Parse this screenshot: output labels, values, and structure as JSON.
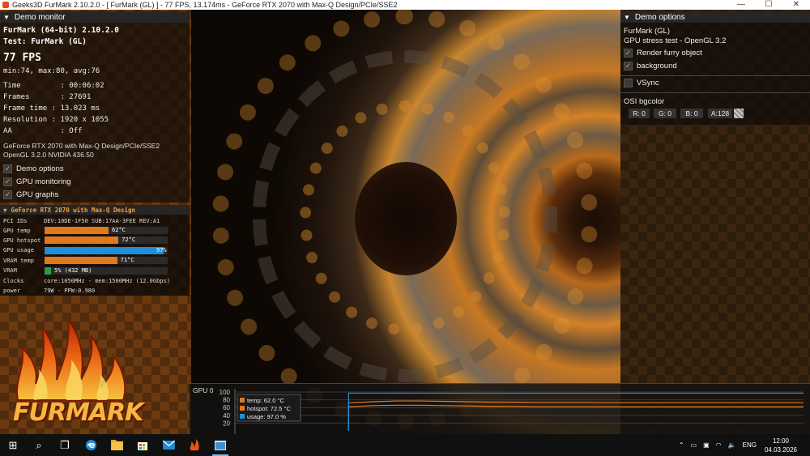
{
  "window": {
    "title": "Geeks3D FurMark 2.10.2.0 - [ FurMark (GL) ] - 77 FPS, 13.174ms - GeForce RTX 2070 with Max-Q Design/PCIe/SSE2",
    "minimize": "—",
    "maximize": "☐",
    "close": "✕"
  },
  "demo_monitor": {
    "header": "Demo monitor",
    "app_name": "FurMark (64-bit) 2.10.2.0",
    "test_name": "Test: FurMark (GL)",
    "fps": "77 FPS",
    "fps_stats": "min:74, max:80, avg:76",
    "time": "Time         : 00:06:02",
    "frames": "Frames       : 27691",
    "frame_time": "Frame time : 13.023 ms",
    "resolution": "Resolution : 1920 x 1055",
    "aa": "AA           : Off",
    "renderer": "GeForce RTX 2070 with Max-Q Design/PCIe/SSE2",
    "gl_version": "OpenGL 3.2.0 NVIDIA 436.50",
    "options": [
      {
        "label": "Demo options",
        "checked": true
      },
      {
        "label": "GPU monitoring",
        "checked": true
      },
      {
        "label": "GPU graphs",
        "checked": true
      }
    ]
  },
  "gpu": {
    "header": "GeForce RTX 2070 with Max-Q Design",
    "pci_label": "PCI IDs",
    "pci_value": "DEV:10DE-1F50 SUB:17AA-3FEE REV:A1",
    "rows": [
      {
        "label": "GPU temp",
        "value": "62°C",
        "fraction": 0.52,
        "color": "#e07820"
      },
      {
        "label": "GPU hotspot",
        "value": "72°C",
        "fraction": 0.6,
        "color": "#e07820"
      },
      {
        "label": "GPU usage",
        "value": "97%",
        "fraction": 0.97,
        "color": "#1e8fd8"
      },
      {
        "label": "VRAM temp",
        "value": "71°C",
        "fraction": 0.59,
        "color": "#e07820"
      },
      {
        "label": "VRAM",
        "value": "5% (432 MB)",
        "fraction": 0.05,
        "color": "#2a9d4a"
      }
    ],
    "clocks_label": "Clocks",
    "clocks_value": "core:1050MHz - mem:1500MHz (12.0Gbps)",
    "power_label": "power",
    "power_value": "79W - PPW:0.980"
  },
  "logo": {
    "text": "FURMARK"
  },
  "demo_options": {
    "header": "Demo options",
    "scene": "FurMark (GL)",
    "subtitle": "GPU stress test - OpenGL 3.2",
    "render_furry": {
      "label": "Render furry object",
      "checked": true
    },
    "background": {
      "label": "background",
      "checked": true
    },
    "vsync": {
      "label": "VSync",
      "checked": false
    },
    "bgcolor_label": "OSI bgcolor",
    "r": "R: 0",
    "g": "G: 0",
    "b": "B: 0",
    "a": "A:128"
  },
  "graph": {
    "title": "GPU 0",
    "y_ticks": [
      "100",
      "80",
      "60",
      "40",
      "20"
    ],
    "legend": [
      {
        "label": "temp: 62.0 °C",
        "color": "#e07820"
      },
      {
        "label": "hotspot: 72.5 °C",
        "color": "#e07820"
      },
      {
        "label": "usage: 97.0 %",
        "color": "#1e8fd8"
      }
    ]
  },
  "chart_data": {
    "type": "line",
    "title": "GPU 0",
    "ylim": [
      0,
      100
    ],
    "series": [
      {
        "name": "temp: 62.0 °C",
        "color": "#e07820",
        "start": 0.2,
        "values": [
          62,
          65,
          66,
          66,
          65,
          64,
          63,
          63,
          62,
          62,
          62,
          62,
          62,
          62,
          62,
          62,
          62,
          62,
          62,
          62
        ]
      },
      {
        "name": "hotspot: 72.5 °C",
        "color": "#e07820",
        "start": 0.2,
        "values": [
          72,
          75,
          77,
          77,
          76,
          75,
          74,
          74,
          73,
          73,
          73,
          72.5,
          72.5,
          72.5,
          72.5,
          72.5,
          72.5,
          72.5,
          72.5,
          72.5
        ]
      },
      {
        "name": "usage: 97.0 %",
        "color": "#1e8fd8",
        "start": 0.2,
        "values": [
          97,
          97,
          97,
          97,
          97,
          97,
          97,
          97,
          97,
          97,
          97,
          97,
          97,
          97,
          97,
          97,
          97,
          97,
          97,
          97
        ]
      }
    ]
  },
  "taskbar": {
    "start": "⊞",
    "search": "⌕",
    "task_view": "❐",
    "language": "ENG",
    "time": "12:00",
    "date": "04.03.2026",
    "tray_chevron": "⌃"
  }
}
